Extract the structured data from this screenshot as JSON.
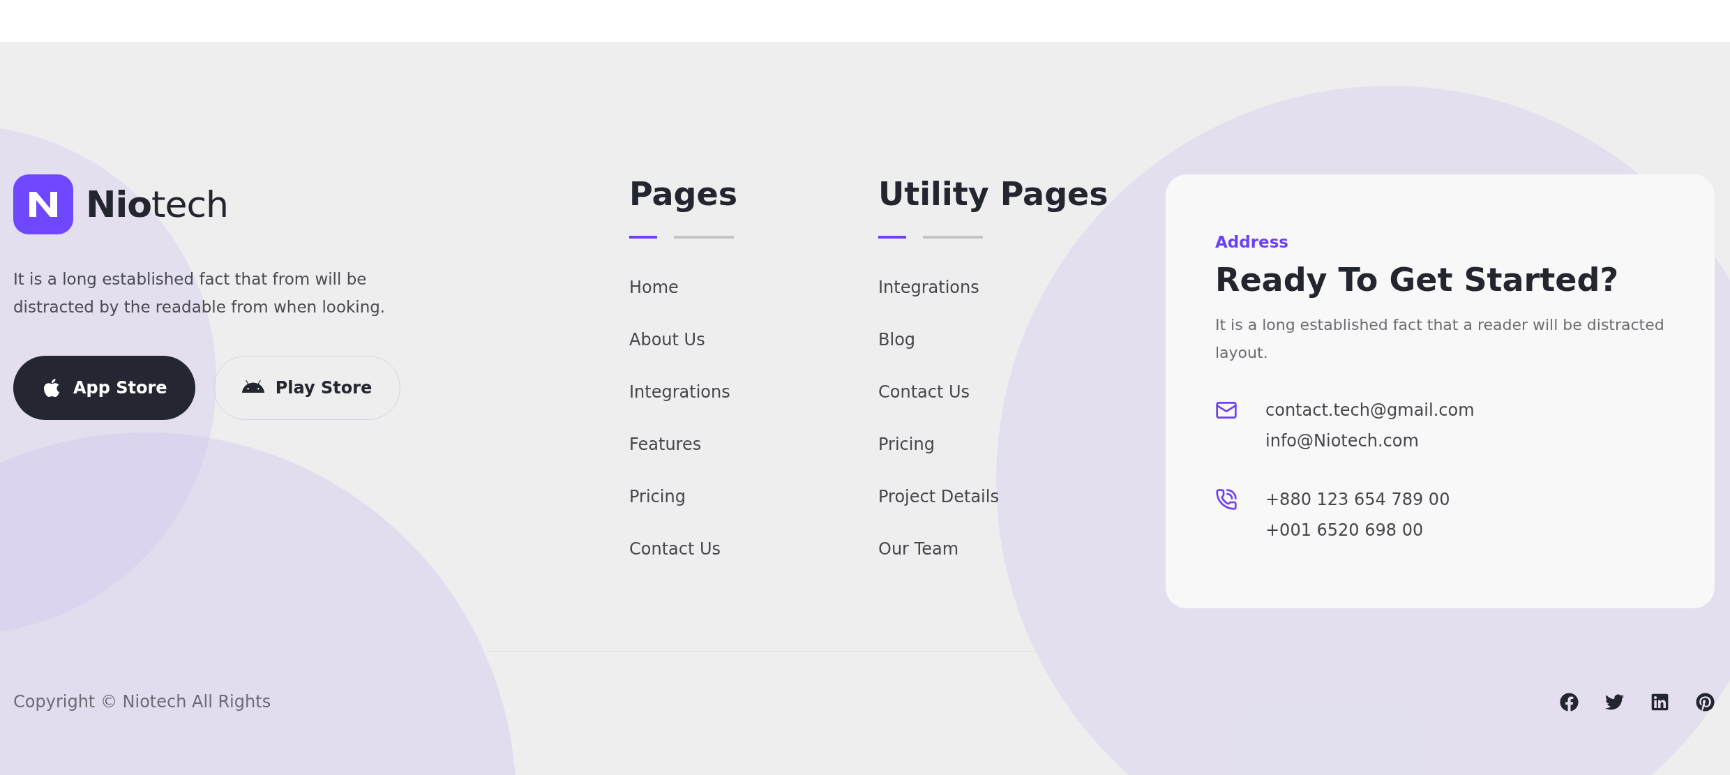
{
  "brand": {
    "name": "**Nio**tech",
    "description": "It is a long established fact that from will be distracted by the readable from when looking.",
    "buttons": [
      {
        "label": "App Store",
        "kind": "apple"
      },
      {
        "label": "Play Store",
        "kind": "android"
      }
    ]
  },
  "columns": [
    {
      "title": "Pages",
      "links": [
        "Home",
        "About Us",
        "Integrations",
        "Features",
        "Pricing",
        "Contact Us"
      ]
    },
    {
      "title": "Utility Pages",
      "links": [
        "Integrations",
        "Blog",
        "Contact Us",
        "Pricing",
        "Project Details",
        "Our Team"
      ]
    }
  ],
  "contact": {
    "label": "Address",
    "title": "Ready To Get Started?",
    "text": "It is a long established fact that a reader will be distracted layout.",
    "groups": [
      {
        "kind": "email",
        "lines": [
          "contact.tech@gmail.com",
          "info@Niotech.com"
        ]
      },
      {
        "kind": "phone",
        "lines": [
          "+880 123 654 789 00",
          "+001 6520 698 00"
        ]
      }
    ]
  },
  "copyright": "Copyright © Niotech All Rights",
  "social": [
    {
      "kind": "facebook"
    },
    {
      "kind": "twitter"
    },
    {
      "kind": "linkedin"
    },
    {
      "kind": "pinterest"
    }
  ]
}
